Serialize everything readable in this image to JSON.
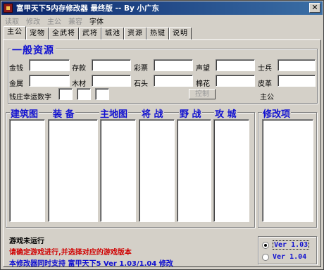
{
  "window": {
    "title": "富甲天下5内存修改器 最终版 -- By 小广东",
    "close_label": "✕"
  },
  "menu": [
    {
      "label": "读取",
      "enabled": false
    },
    {
      "label": "修改",
      "enabled": false
    },
    {
      "label": "主公",
      "enabled": false
    },
    {
      "label": "兼容",
      "enabled": false
    },
    {
      "label": "字体",
      "enabled": true
    }
  ],
  "tabs": [
    "主公",
    "宠物",
    "全武将",
    "武将",
    "城池",
    "资源",
    "热键",
    "说明"
  ],
  "resources": {
    "title": "一般资源",
    "fields": [
      "金钱",
      "存款",
      "彩票",
      "声望",
      "士兵",
      "金属",
      "木材",
      "石头",
      "棉花",
      "皮革"
    ],
    "lucky_label": "钱庄幸运数字",
    "control_button": "控制",
    "lord_label": "主公"
  },
  "lists": {
    "headers": [
      "建筑图",
      "装 备",
      "主地图",
      "将 战",
      "野 战",
      "攻 城"
    ],
    "modify_header": "修改项"
  },
  "status": {
    "game_state": "游戏未运行",
    "warning": "请确定游戏进行,并选择对应的游戏版本",
    "support": "本修改器同时支持 富甲天下5 Ver 1.03/1.04 修改"
  },
  "versions": [
    {
      "label": "Ver 1.03",
      "selected": true
    },
    {
      "label": "Ver 1.04",
      "selected": false
    }
  ],
  "colors": {
    "titlebar": "#0a246a",
    "accent_blue": "#1010d0",
    "warning_red": "#d00000",
    "face": "#d4d0c8"
  }
}
